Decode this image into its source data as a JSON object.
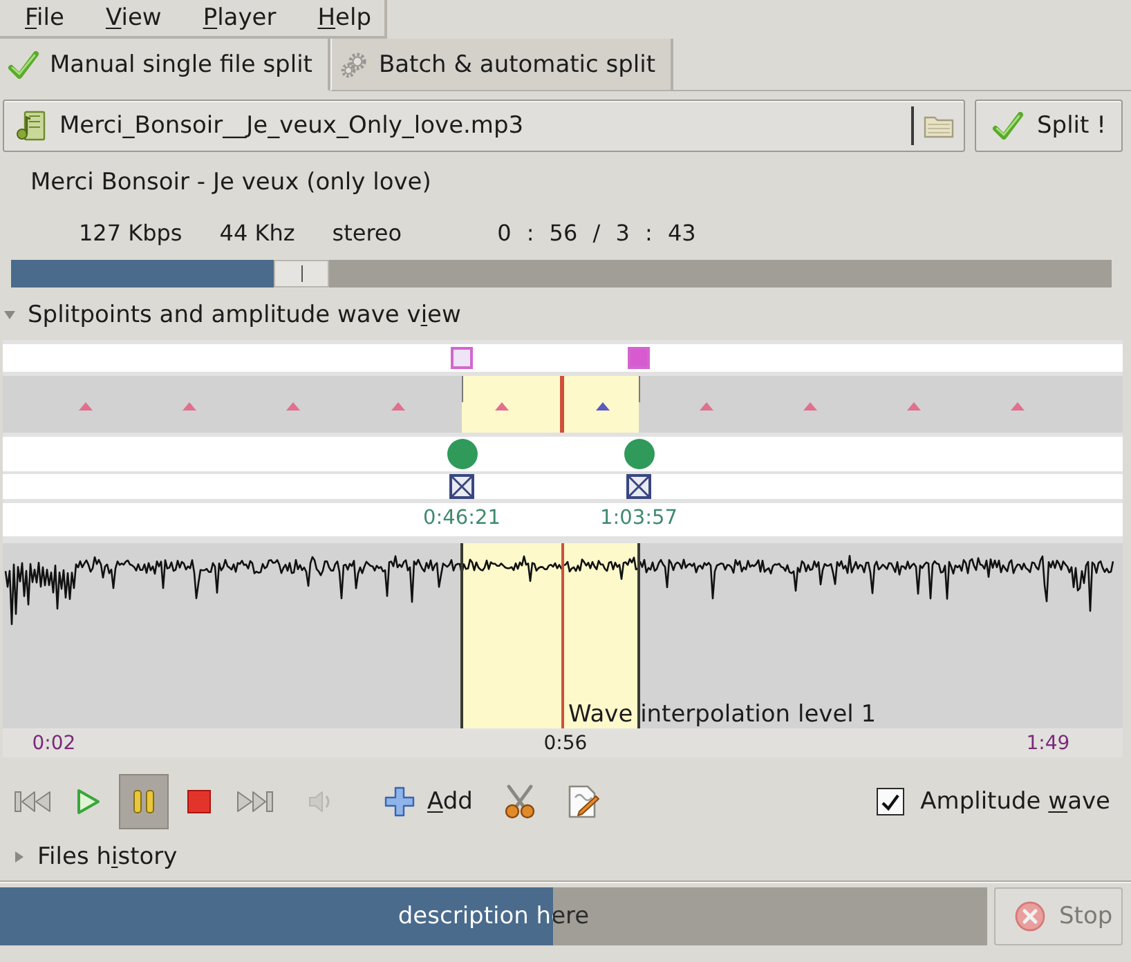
{
  "menu_bar": [
    {
      "mnemonic": "F",
      "label_end": "ile"
    },
    {
      "mnemonic": "V",
      "label_end": "iew"
    },
    {
      "mnemonic": "P",
      "label_end": "layer"
    },
    {
      "mnemonic": "H",
      "label_end": "elp"
    }
  ],
  "tabs": [
    {
      "label": "Manual single file split",
      "kind": "check",
      "selected": true
    },
    {
      "label": "Batch & automatic split",
      "kind": "gears",
      "selected": false
    }
  ],
  "file_field": {
    "value": "Merci_Bonsoir__Je_veux_Only_love.mp3"
  },
  "split_button": {
    "label": "Split !"
  },
  "song": {
    "title": "Merci Bonsoir - Je veux (only love)",
    "bitrate": "127 Kbps",
    "frequency": "44 Khz",
    "channels": "stereo",
    "time": "0 : 56 / 3 : 43"
  },
  "seek_bar": {
    "level": 0.251
  },
  "splitpoints_view": {
    "label_start": "Splitpoints and amplitude wave v",
    "mnemonic": "i",
    "label_end": "ew",
    "expanded": true,
    "tick_markers": [
      {
        "color": "#e0708e"
      },
      {
        "color": "#e0708e"
      },
      {
        "color": "#e0708e"
      },
      {
        "color": "#e0708e"
      },
      {
        "color": "#e0708e"
      },
      {
        "color": "#5a5ac0"
      },
      {
        "color": "#e0708e"
      },
      {
        "color": "#e0708e"
      },
      {
        "color": "#e0708e"
      },
      {
        "color": "#e0708e"
      }
    ],
    "splitpoints": [
      {
        "time": "0:46:21",
        "checked": false
      },
      {
        "time": "1:03:57",
        "checked": true
      }
    ],
    "wave_caption": "Wave interpolation level 1",
    "timeline": [
      {
        "label": "0:02",
        "kind": "bound"
      },
      {
        "label": "0:56",
        "kind": "cursor"
      },
      {
        "label": "1:49",
        "kind": "bound"
      }
    ]
  },
  "player_controls": [
    {
      "kind": "previous",
      "selected": false,
      "disabled": false
    },
    {
      "kind": "play",
      "selected": false,
      "disabled": false
    },
    {
      "kind": "pause",
      "selected": true,
      "disabled": false
    },
    {
      "kind": "stop",
      "selected": false,
      "disabled": false
    },
    {
      "kind": "next",
      "selected": false,
      "disabled": false
    },
    {
      "kind": "volume",
      "selected": false,
      "disabled": true
    }
  ],
  "actions": [
    {
      "kind": "add",
      "mnemonic": "A",
      "label_end": "dd"
    },
    {
      "kind": "cut"
    },
    {
      "kind": "edit"
    }
  ],
  "amplitude_wave": {
    "label_start": "Amplitude ",
    "mnemonic": "w",
    "label_end": "ave",
    "checked": true
  },
  "files_history": {
    "label_start": "Files h",
    "mnemonic": "i",
    "label_end": "story",
    "expanded": false
  },
  "status": {
    "text": "description here",
    "level": 0.56
  },
  "stop_button": {
    "label": "Stop",
    "disabled": true
  }
}
